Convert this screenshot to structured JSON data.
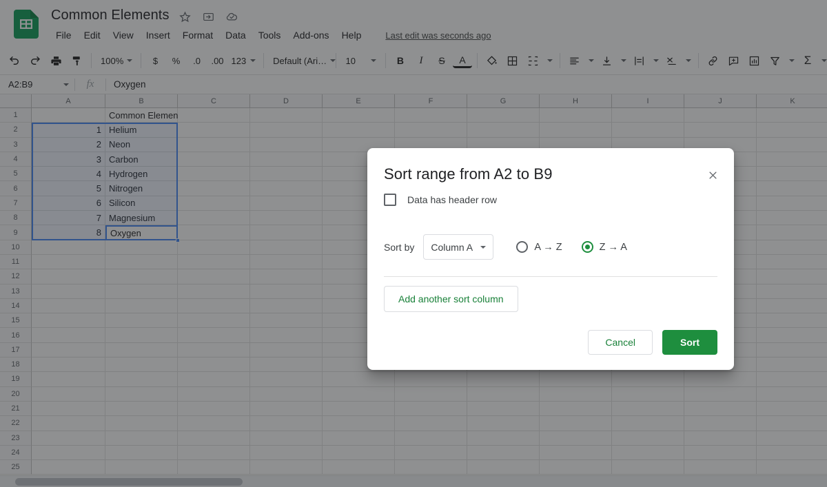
{
  "app": {
    "document_title": "Common Elements",
    "logo_icon": "sheets-logo-icon",
    "title_icons": [
      "star-icon",
      "move-to-folder-icon",
      "cloud-saved-icon"
    ],
    "last_edit": "Last edit was seconds ago"
  },
  "menus": [
    {
      "label": "File"
    },
    {
      "label": "Edit"
    },
    {
      "label": "View"
    },
    {
      "label": "Insert"
    },
    {
      "label": "Format"
    },
    {
      "label": "Data"
    },
    {
      "label": "Tools"
    },
    {
      "label": "Add-ons"
    },
    {
      "label": "Help"
    }
  ],
  "toolbar": {
    "undo_icon": "undo-icon",
    "redo_icon": "redo-icon",
    "print_icon": "print-icon",
    "paint_format_icon": "paint-format-icon",
    "zoom_value": "100%",
    "currency_icon": "$",
    "percent_icon": "%",
    "decrease_decimal_icon": ".0",
    "increase_decimal_icon": ".00",
    "more_formats_label": "123",
    "font_value": "Default (Ari…",
    "font_size_value": "10",
    "bold_label": "B",
    "italic_label": "I",
    "strikethrough_label": "S",
    "text_color_label": "A",
    "fill_color_icon": "fill-color-icon",
    "borders_icon": "borders-icon",
    "merge_cells_icon": "merge-cells-icon",
    "horizontal_align_icon": "horizontal-align-icon",
    "vertical_align_icon": "vertical-align-icon",
    "text_wrap_icon": "text-wrap-icon",
    "text_rotation_icon": "text-rotation-icon",
    "insert_link_icon": "insert-link-icon",
    "insert_comment_icon": "insert-comment-icon",
    "insert_chart_icon": "insert-chart-icon",
    "filter_icon": "filter-icon",
    "functions_icon": "functions-sigma-icon"
  },
  "formula_bar": {
    "name_box_value": "A2:B9",
    "fx_label": "fx",
    "cell_value": "Oxygen"
  },
  "grid": {
    "columns": [
      "A",
      "B",
      "C",
      "D",
      "E",
      "F",
      "G",
      "H",
      "I",
      "J",
      "K"
    ],
    "rows": [
      1,
      2,
      3,
      4,
      5,
      6,
      7,
      8,
      9,
      10,
      11,
      12,
      13,
      14,
      15,
      16,
      17,
      18,
      19,
      20,
      21,
      22,
      23,
      24,
      25
    ],
    "cells": [
      {
        "row": 1,
        "a": "",
        "b": "Common Elements"
      },
      {
        "row": 2,
        "a": "1",
        "b": "Helium"
      },
      {
        "row": 3,
        "a": "2",
        "b": "Neon"
      },
      {
        "row": 4,
        "a": "3",
        "b": "Carbon"
      },
      {
        "row": 5,
        "a": "4",
        "b": "Hydrogen"
      },
      {
        "row": 6,
        "a": "5",
        "b": "Nitrogen"
      },
      {
        "row": 7,
        "a": "6",
        "b": "Silicon"
      },
      {
        "row": 8,
        "a": "7",
        "b": "Magnesium"
      },
      {
        "row": 9,
        "a": "8",
        "b": "Oxygen"
      }
    ],
    "selection_range": "A2:B9",
    "active_cell": "B9"
  },
  "dialog": {
    "title": "Sort range from A2 to B9",
    "close_icon": "close-icon",
    "header_checkbox": {
      "label": "Data has header row",
      "checked": false
    },
    "sort_by_label": "Sort by",
    "column_select_value": "Column A",
    "order_options": [
      {
        "label": "A → Z",
        "selected": false
      },
      {
        "label": "Z → A",
        "selected": true
      }
    ],
    "add_column_label": "Add another sort column",
    "cancel_label": "Cancel",
    "sort_label": "Sort"
  },
  "colors": {
    "brand_green": "#1e8e3e",
    "link_green": "#188038",
    "selection_blue": "#4285f4"
  }
}
